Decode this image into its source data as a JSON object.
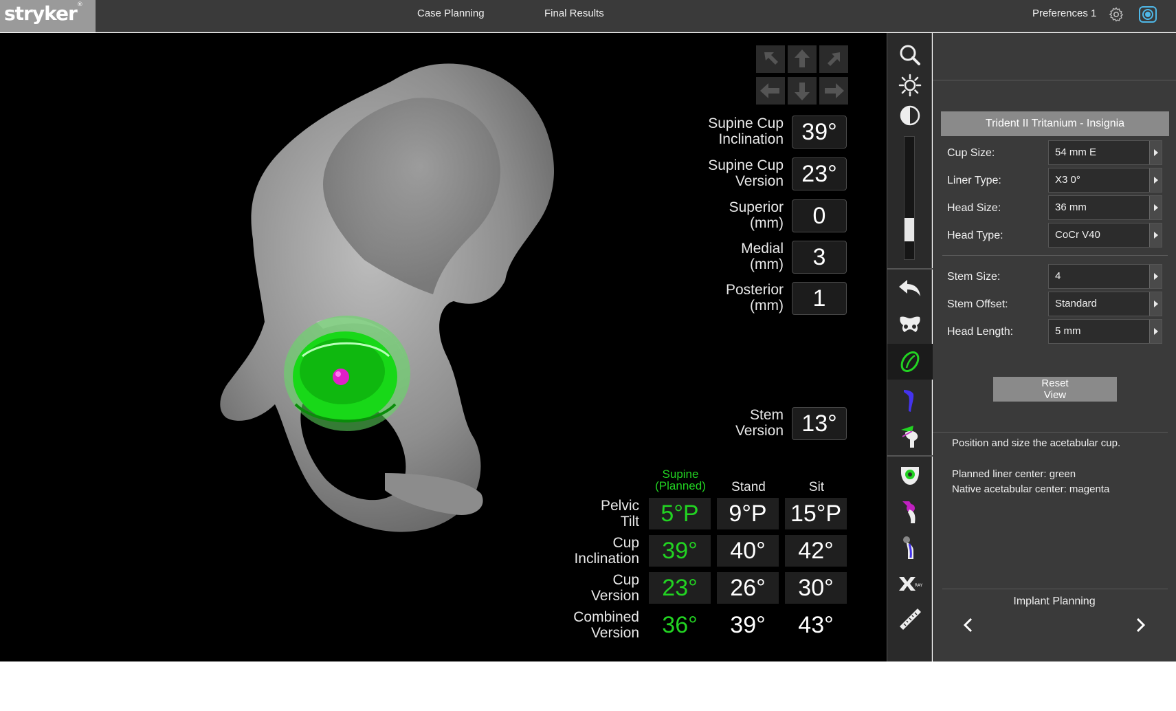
{
  "header": {
    "logo_text": "stryker",
    "logo_mark": "®",
    "nav": [
      "Case Planning",
      "Final Results"
    ],
    "preferences_label": "Preferences 1"
  },
  "viewport": {
    "params": [
      {
        "label_lines": [
          "Supine Cup",
          "Inclination"
        ],
        "value": "39°"
      },
      {
        "label_lines": [
          "Supine Cup",
          "Version"
        ],
        "value": "23°"
      },
      {
        "label_lines": [
          "Superior",
          "(mm)"
        ],
        "value": "0"
      },
      {
        "label_lines": [
          "Medial",
          "(mm)"
        ],
        "value": "3"
      },
      {
        "label_lines": [
          "Posterior",
          "(mm)"
        ],
        "value": "1"
      }
    ],
    "stem_version": {
      "label_lines": [
        "Stem",
        "Version"
      ],
      "value": "13°"
    },
    "table": {
      "columns": [
        {
          "label_lines": [
            "Supine",
            "(Planned)"
          ]
        },
        {
          "label_lines": [
            "Stand"
          ]
        },
        {
          "label_lines": [
            "Sit"
          ]
        }
      ],
      "rows": [
        {
          "label_lines": [
            "Pelvic",
            "Tilt"
          ],
          "values": [
            "5°P",
            "9°P",
            "15°P"
          ]
        },
        {
          "label_lines": [
            "Cup",
            "Inclination"
          ],
          "values": [
            "39°",
            "40°",
            "42°"
          ]
        },
        {
          "label_lines": [
            "Cup",
            "Version"
          ],
          "values": [
            "23°",
            "26°",
            "30°"
          ]
        },
        {
          "label_lines": [
            "Combined",
            "Version"
          ],
          "values": [
            "36°",
            "39°",
            "43°"
          ]
        }
      ]
    },
    "brightness_level_fraction": 0.18
  },
  "panel": {
    "implant_title": "Trident II Tritanium - Insignia",
    "fields_group1": [
      {
        "label": "Cup Size:",
        "value": "54 mm E"
      },
      {
        "label": "Liner Type:",
        "value": "X3 0°"
      },
      {
        "label": "Head Size:",
        "value": "36 mm"
      },
      {
        "label": "Head Type:",
        "value": "CoCr V40"
      }
    ],
    "fields_group2": [
      {
        "label": "Stem Size:",
        "value": "4"
      },
      {
        "label": "Stem Offset:",
        "value": "Standard"
      },
      {
        "label": "Head Length:",
        "value": "5 mm"
      }
    ],
    "reset_lines": [
      "Reset",
      "View"
    ],
    "info_lines": [
      "Position and size the acetabular cup.",
      "Planned liner center: green",
      "Native acetabular center: magenta"
    ],
    "step_label": "Implant Planning"
  },
  "colors": {
    "planned_green": "#22d322",
    "native_magenta": "#e020c8",
    "topbar": "#3a3a3a",
    "logo_bg": "#9a9a9a"
  },
  "icons": [
    "gear-icon",
    "camera-icon",
    "zoom-icon",
    "brightness-icon",
    "contrast-icon",
    "undo-icon",
    "pelvis-icon",
    "cup-icon",
    "stem-icon",
    "femur-resection-icon",
    "acetabulum-icon",
    "hip-joint-icon",
    "femur-stem-icon",
    "xray-icon",
    "ruler-icon"
  ]
}
